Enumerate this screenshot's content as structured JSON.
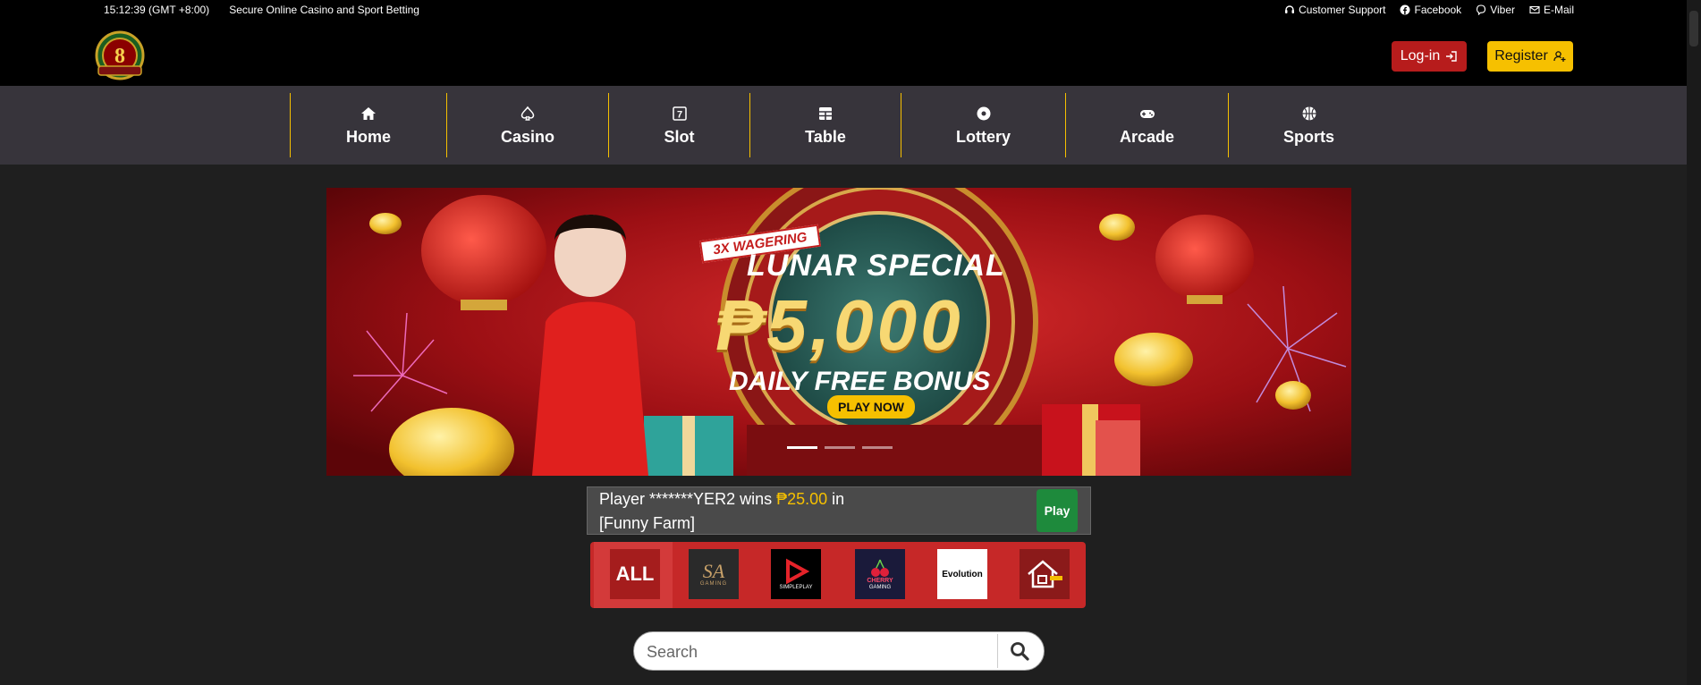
{
  "topbar": {
    "clock": "15:12:39 (GMT +8:00)",
    "tagline": "Secure Online Casino and Sport Betting",
    "links": [
      {
        "label": "Customer Support",
        "icon": "headset-icon"
      },
      {
        "label": "Facebook",
        "icon": "facebook-icon"
      },
      {
        "label": "Viber",
        "icon": "viber-icon"
      },
      {
        "label": "E-Mail",
        "icon": "email-icon"
      }
    ]
  },
  "logo": {
    "text": "8"
  },
  "auth": {
    "login_label": "Log-in",
    "register_label": "Register"
  },
  "nav": [
    {
      "label": "Home",
      "icon": "home-icon"
    },
    {
      "label": "Casino",
      "icon": "spade-icon"
    },
    {
      "label": "Slot",
      "icon": "slot-seven-icon",
      "glyph": "7"
    },
    {
      "label": "Table",
      "icon": "table-grid-icon"
    },
    {
      "label": "Lottery",
      "icon": "lottery-ball-icon"
    },
    {
      "label": "Arcade",
      "icon": "gamepad-icon"
    },
    {
      "label": "Sports",
      "icon": "basketball-icon"
    }
  ],
  "banner": {
    "badge": "3X WAGERING",
    "headline": "LUNAR SPECIAL",
    "amount": "₱5,000",
    "subheadline": "DAILY FREE BONUS",
    "cta": "PLAY NOW",
    "slide_count": 3,
    "active_slide": 1
  },
  "ticker": {
    "prefix": "Player *******YER2 wins ",
    "amount": "₱25.00",
    "suffix": " in",
    "game": "[Funny Farm]",
    "play_label": "Play"
  },
  "providers": [
    {
      "name": "ALL",
      "label": "ALL"
    },
    {
      "name": "SA Gaming",
      "label": "SA",
      "sub": "GAMING"
    },
    {
      "name": "SimplePlay",
      "label": "SIMPLEPLAY"
    },
    {
      "name": "Cherry Gaming",
      "label": "CHERRY",
      "sub": "GAMING"
    },
    {
      "name": "Evolution",
      "label": "Evolution"
    },
    {
      "name": "House",
      "label": ""
    }
  ],
  "search": {
    "placeholder": "Search"
  },
  "colors": {
    "accent_gold": "#f6c000",
    "login_red": "#b71c1c",
    "nav_bg": "#37343b",
    "play_green": "#1e8a3c"
  }
}
